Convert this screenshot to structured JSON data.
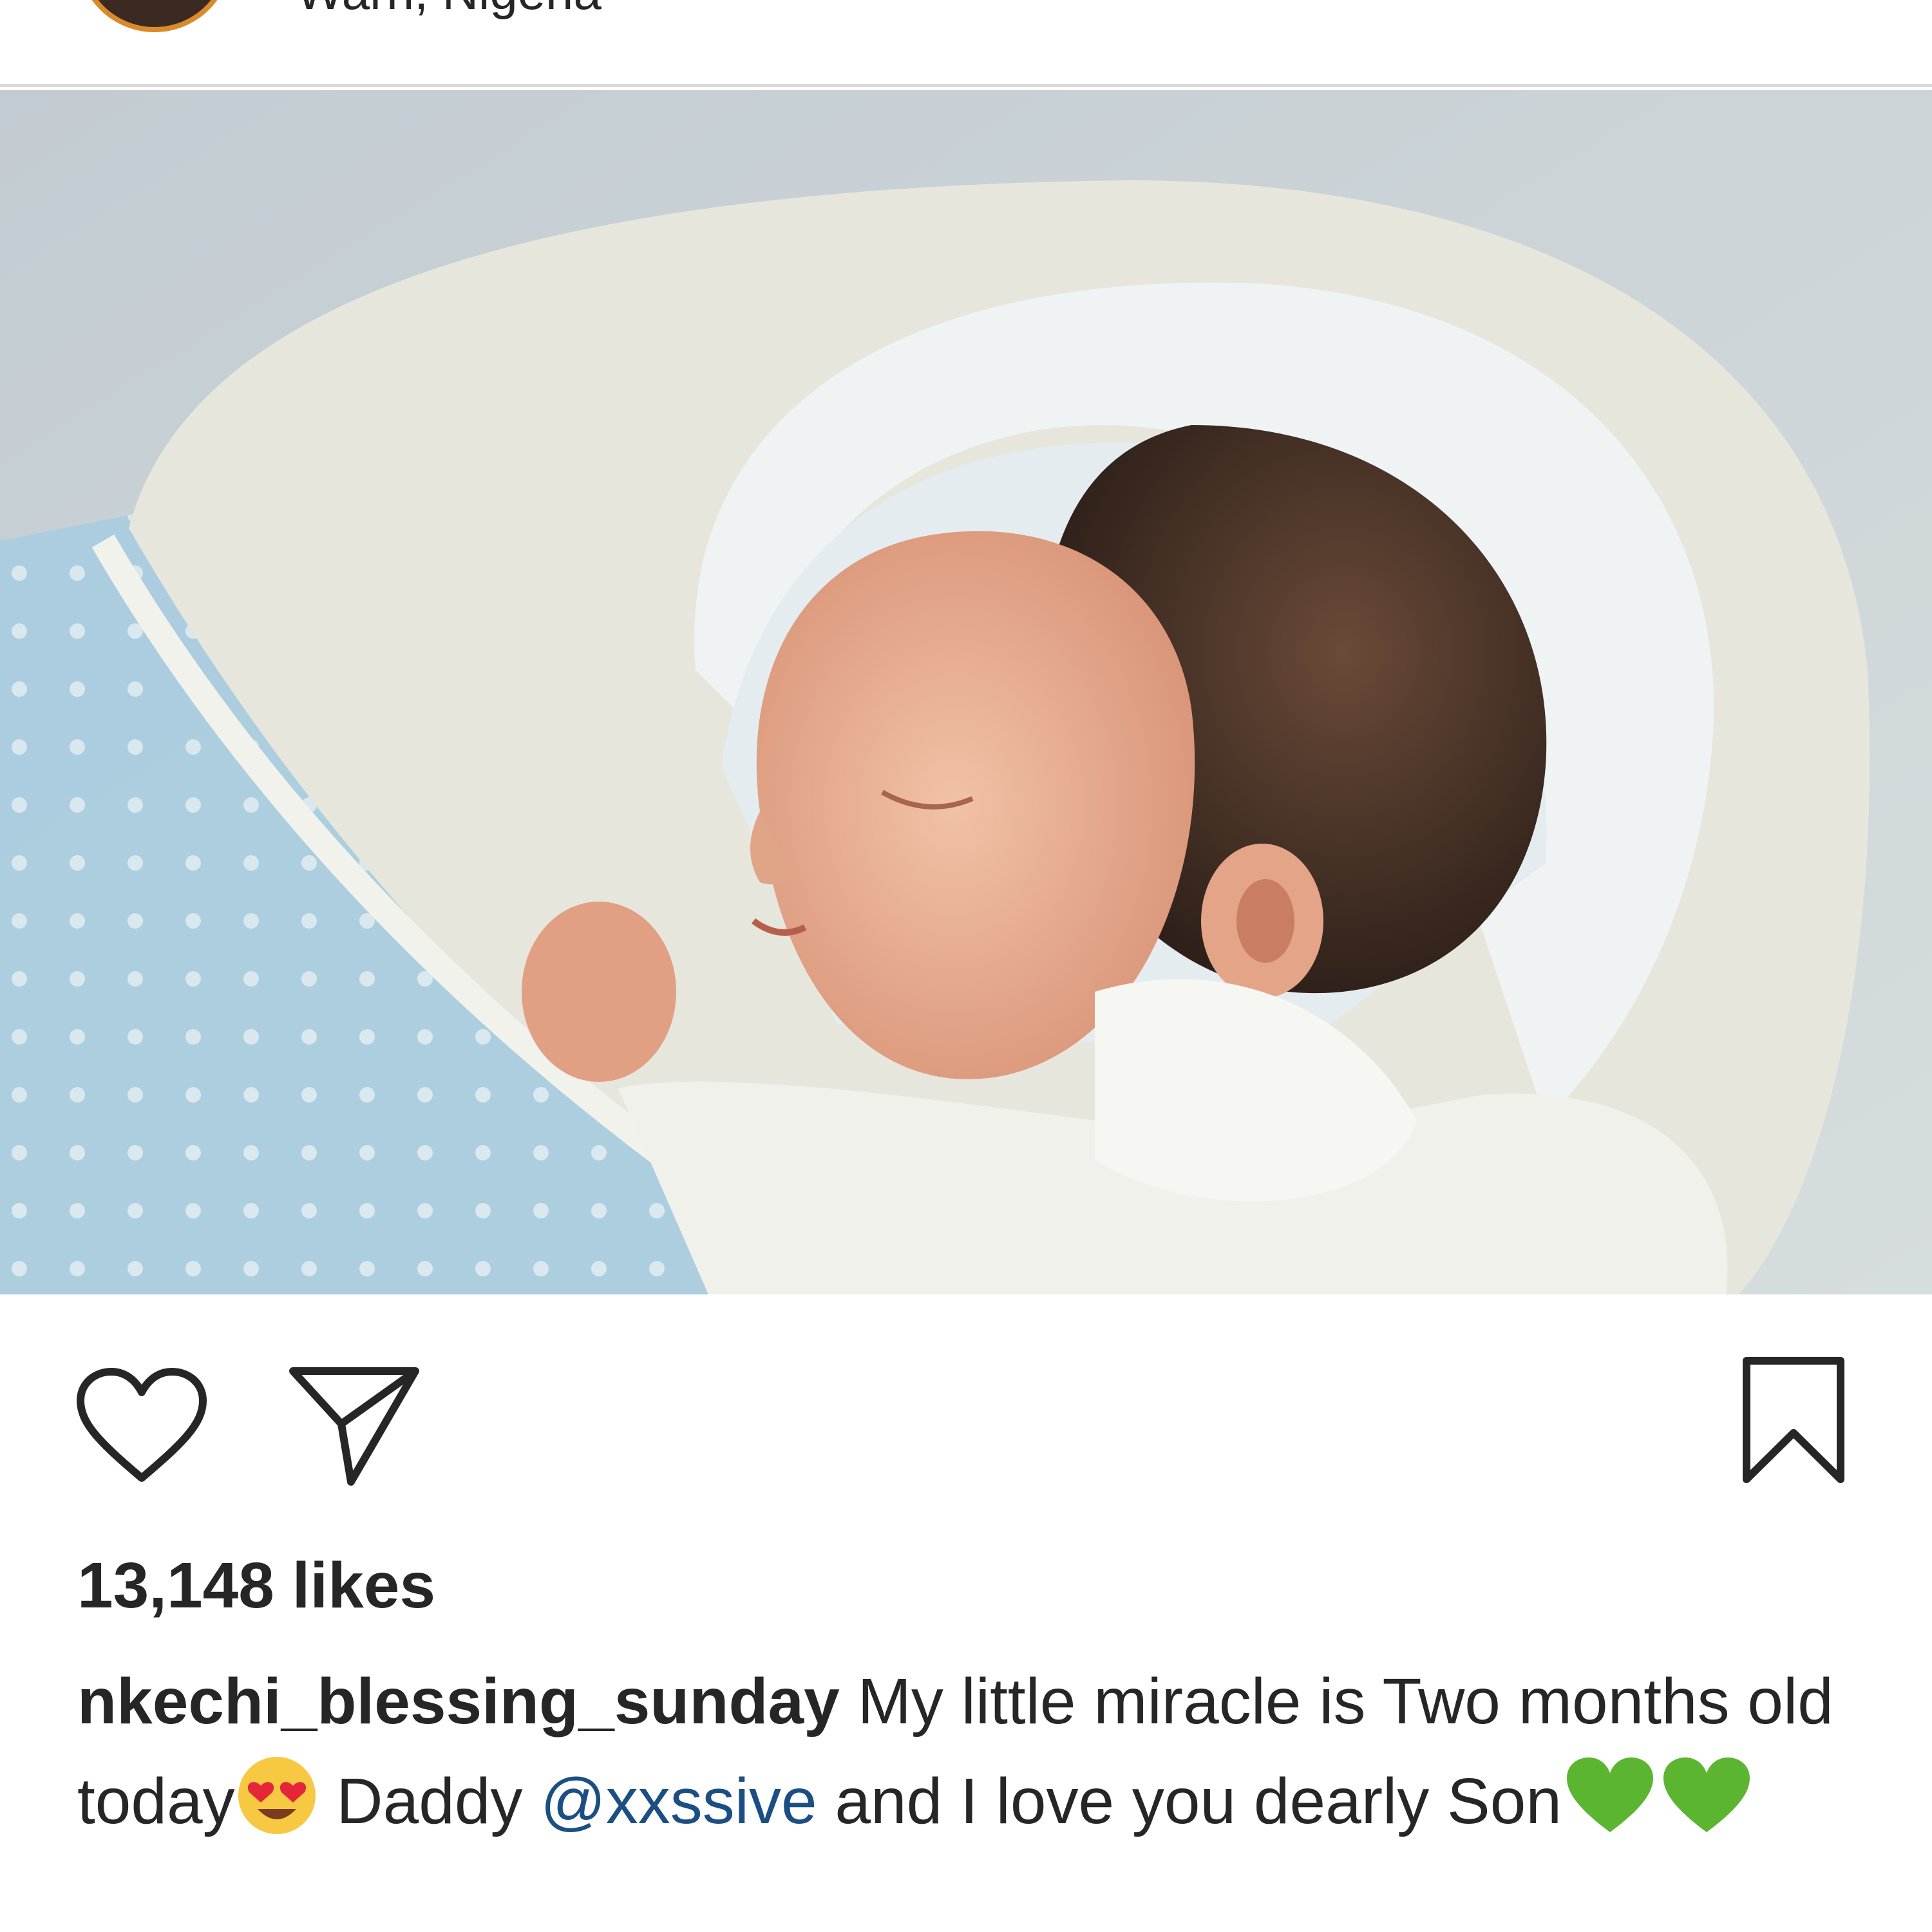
{
  "post": {
    "location": "Warri, Nigeria",
    "likes_text": "13,148 likes",
    "caption": {
      "username": "nkechi_blessing_sunday",
      "text_1": " My little miracle is Two months old today",
      "emoji_1": "heart-eyes-emoji",
      "text_2": " Daddy ",
      "mention": "@xxssive",
      "text_3": " and I love you dearly Son",
      "emoji_2": "green-heart-emoji"
    }
  },
  "actions": {
    "like_icon": "heart-outline-icon",
    "share_icon": "paper-plane-icon",
    "save_icon": "bookmark-icon"
  },
  "colors": {
    "mention": "#1b4f84",
    "text": "#262626",
    "divider": "#dbdbdb",
    "green_heart": "#5cb531"
  }
}
